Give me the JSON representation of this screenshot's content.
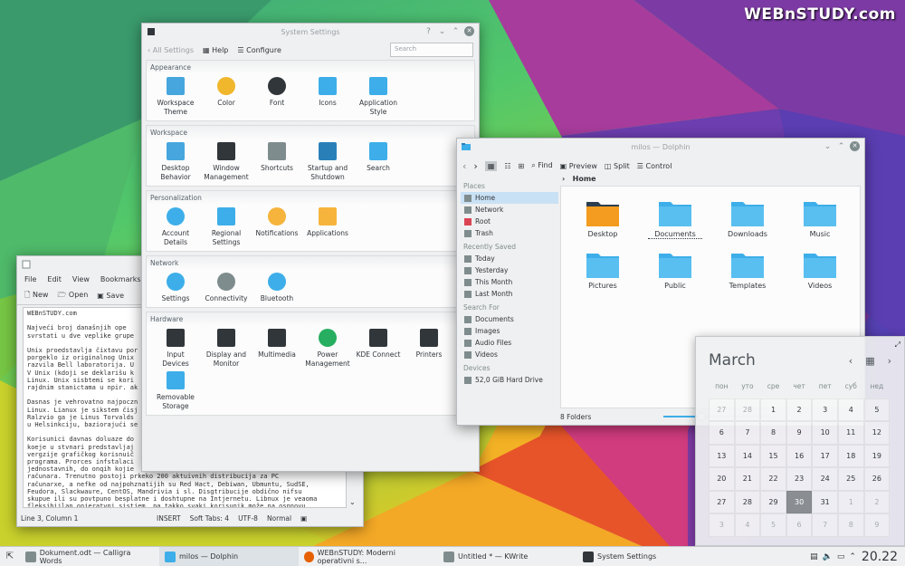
{
  "watermark": "WEBnSTUDY.com",
  "settings": {
    "title": "System Settings",
    "back_label": "All Settings",
    "help_label": "Help",
    "configure_label": "Configure",
    "search_placeholder": "Search",
    "groups": [
      {
        "title": "Appearance",
        "items": [
          {
            "label": "Workspace\nTheme",
            "icon": "workspace-theme-icon",
            "color": "#47a6dd"
          },
          {
            "label": "Color",
            "icon": "color-icon",
            "color": "#f0b72c"
          },
          {
            "label": "Font",
            "icon": "font-icon",
            "color": "#31363b"
          },
          {
            "label": "Icons",
            "icon": "icons-icon",
            "color": "#3daee9"
          },
          {
            "label": "Application\nStyle",
            "icon": "application-style-icon",
            "color": "#3daee9"
          }
        ]
      },
      {
        "title": "Workspace",
        "items": [
          {
            "label": "Desktop\nBehavior",
            "icon": "desktop-behavior-icon",
            "color": "#47a6dd"
          },
          {
            "label": "Window\nManagement",
            "icon": "window-management-icon",
            "color": "#31363b"
          },
          {
            "label": "Shortcuts",
            "icon": "shortcuts-icon",
            "color": "#7f8c8d"
          },
          {
            "label": "Startup and\nShutdown",
            "icon": "startup-icon",
            "color": "#2980b9"
          },
          {
            "label": "Search",
            "icon": "search-icon",
            "color": "#3daee9"
          }
        ]
      },
      {
        "title": "Personalization",
        "items": [
          {
            "label": "Account\nDetails",
            "icon": "account-icon",
            "color": "#3daee9"
          },
          {
            "label": "Regional\nSettings",
            "icon": "regional-icon",
            "color": "#3daee9"
          },
          {
            "label": "Notifications",
            "icon": "notifications-icon",
            "color": "#f6b43c"
          },
          {
            "label": "Applications",
            "icon": "applications-icon",
            "color": "#f6b43c"
          }
        ]
      },
      {
        "title": "Network",
        "items": [
          {
            "label": "Settings",
            "icon": "network-settings-icon",
            "color": "#3daee9"
          },
          {
            "label": "Connectivity",
            "icon": "connectivity-icon",
            "color": "#7f8c8d"
          },
          {
            "label": "Bluetooth",
            "icon": "bluetooth-icon",
            "color": "#3daee9"
          }
        ]
      },
      {
        "title": "Hardware",
        "items": [
          {
            "label": "Input\nDevices",
            "icon": "input-devices-icon",
            "color": "#31363b"
          },
          {
            "label": "Display and\nMonitor",
            "icon": "display-icon",
            "color": "#31363b"
          },
          {
            "label": "Multimedia",
            "icon": "multimedia-icon",
            "color": "#31363b"
          },
          {
            "label": "Power\nManagement",
            "icon": "power-icon",
            "color": "#27ae60"
          },
          {
            "label": "KDE Connect",
            "icon": "kde-connect-icon",
            "color": "#31363b"
          },
          {
            "label": "Printers",
            "icon": "printer-icon",
            "color": "#31363b"
          },
          {
            "label": "Removable\nStorage",
            "icon": "removable-storage-icon",
            "color": "#3daee9"
          }
        ]
      }
    ]
  },
  "kwrite": {
    "menu": [
      "File",
      "Edit",
      "View",
      "Bookmarks"
    ],
    "toolbar": {
      "new": "New",
      "open": "Open",
      "save": "Save"
    },
    "text": "WEBnSTUDY.com\n\nNajveći broj današnjih ope\nsvrstati u dve veplike grupe\n\nUnix proedstavlja čixtavu por\nporgeklo iz originalnog Unix\nrazvila Bell laboratorija. U\nV Unix (kdoji se deklarišu k\nLinux. Unix sisbtemi se kori\nrajdnim stanictama u npir. ak\n\nDasnas je vehrovatno najpoczn\nLinux. Lianux je sikstem čisj\nRalzvio ga je Linus Torvalds\nu Helsinkciju, baziorajući se\n\nKorisunici davnas doluaze do\nkoeje u stvnari predstavljaj\nvergzije grafičkog korisnuič\nprograma. Prorces infstalaci\njednostavnih, do onqih kojie\nračunara. Trenutno postoji prkeko 200 aktuivnih distribucija za PC\nračunarxe, a nefke od najpohznatijih su Red Hact, Debiwan, Ubmuntu, SudSE,\nFeudora, Slackwaure, CentOS, Mandrivia i sl. Disgtribucije obdično nifsu\nskupue ili su povtpuno besplatne i doshtupne na Intjernetu. Libnux je veaoma\nfleksibiilan onjeratvni sistjem, pa takko svaki korisunik može na osnnovu",
    "status": {
      "position": "Line 3, Column 1",
      "mode": "INSERT",
      "tabs": "Soft Tabs: 4",
      "encoding": "UTF-8",
      "syntax": "Normal"
    }
  },
  "dolphin": {
    "title": "milos — Dolphin",
    "toolbar": {
      "find": "Find",
      "preview": "Preview",
      "split": "Split",
      "control": "Control"
    },
    "breadcrumb": "Home",
    "sidebar": [
      {
        "section": "Places",
        "items": [
          {
            "label": "Home",
            "icon": "home-icon",
            "selected": true
          },
          {
            "label": "Network",
            "icon": "network-icon"
          },
          {
            "label": "Root",
            "icon": "root-icon"
          },
          {
            "label": "Trash",
            "icon": "trash-icon"
          }
        ]
      },
      {
        "section": "Recently Saved",
        "items": [
          {
            "label": "Today",
            "icon": "calendar-icon"
          },
          {
            "label": "Yesterday",
            "icon": "calendar-icon"
          },
          {
            "label": "This Month",
            "icon": "calendar-icon"
          },
          {
            "label": "Last Month",
            "icon": "calendar-icon"
          }
        ]
      },
      {
        "section": "Search For",
        "items": [
          {
            "label": "Documents",
            "icon": "documents-icon"
          },
          {
            "label": "Images",
            "icon": "images-icon"
          },
          {
            "label": "Audio Files",
            "icon": "audio-icon"
          },
          {
            "label": "Videos",
            "icon": "videos-icon"
          }
        ]
      },
      {
        "section": "Devices",
        "items": [
          {
            "label": "52,0 GiB Hard Drive",
            "icon": "hard-drive-icon"
          }
        ]
      }
    ],
    "folders": [
      "Desktop",
      "Documents",
      "Downloads",
      "Music",
      "Pictures",
      "Public",
      "Templates",
      "Videos"
    ],
    "status": "8 Folders",
    "zoom_fraction": 0.35
  },
  "calendar": {
    "month": "March",
    "weekdays": [
      "пон",
      "уто",
      "сре",
      "чет",
      "пет",
      "суб",
      "нед"
    ],
    "days": [
      [
        "27",
        "28",
        "1",
        "2",
        "3",
        "4",
        "5"
      ],
      [
        "6",
        "7",
        "8",
        "9",
        "10",
        "11",
        "12"
      ],
      [
        "13",
        "14",
        "15",
        "16",
        "17",
        "18",
        "19"
      ],
      [
        "20",
        "21",
        "22",
        "23",
        "24",
        "25",
        "26"
      ],
      [
        "27",
        "28",
        "29",
        "30",
        "31",
        "1",
        "2"
      ],
      [
        "3",
        "4",
        "5",
        "6",
        "7",
        "8",
        "9"
      ]
    ],
    "today": "30"
  },
  "taskbar": {
    "tasks": [
      {
        "label": "Dokument.odt — Calligra Words",
        "icon": "calligra-icon",
        "color": "#7f8c8d"
      },
      {
        "label": "milos — Dolphin",
        "icon": "dolphin-icon",
        "color": "#3daee9"
      },
      {
        "label": "WEBnSTUDY: Moderni operativni s...",
        "icon": "firefox-icon",
        "color": "#e66000"
      },
      {
        "label": "Untitled * — KWrite",
        "icon": "kwrite-icon",
        "color": "#7f8c8d"
      },
      {
        "label": "System Settings",
        "icon": "settings-icon",
        "color": "#31363b"
      }
    ],
    "clock": "20.22"
  },
  "colors": {
    "accent": "#3daee9",
    "folder": "#3daee9",
    "selection": "#c9e1f5"
  }
}
